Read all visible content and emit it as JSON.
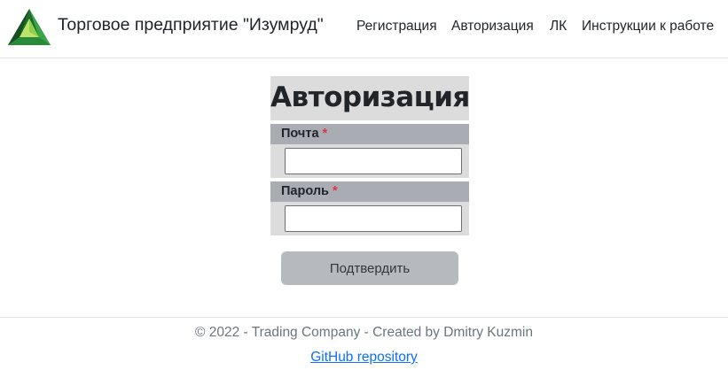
{
  "header": {
    "brand": "Торговое предприятие \"Изумруд\"",
    "nav": [
      "Регистрация",
      "Авторизация",
      "ЛК",
      "Инструкции к работе"
    ]
  },
  "form": {
    "title": "Авторизация",
    "email_label": "Почта",
    "email_value": "",
    "password_label": "Пароль",
    "password_value": "",
    "required_mark": "*",
    "submit_label": "Подтвердить"
  },
  "footer": {
    "copyright": "© 2022 - Trading Company - Created by Dmitry Kuzmin",
    "github_link": "GitHub repository"
  },
  "colors": {
    "logo_green": "#2f8f3f",
    "required": "#dc3545",
    "link": "#0d6efd",
    "label_band": "#a9acb2",
    "panel": "#dcdcdc"
  }
}
